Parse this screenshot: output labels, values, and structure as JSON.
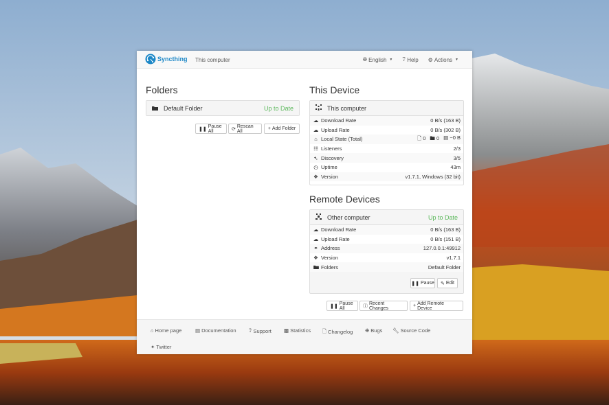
{
  "navbar": {
    "brand": "Syncthing",
    "device_name": "This computer",
    "language": "English",
    "help": "Help",
    "actions": "Actions"
  },
  "folders": {
    "heading": "Folders",
    "items": [
      {
        "name": "Default Folder",
        "status": "Up to Date"
      }
    ],
    "buttons": {
      "pause_all": "Pause All",
      "rescan_all": "Rescan All",
      "add_folder": "Add Folder"
    }
  },
  "this_device": {
    "heading": "This Device",
    "name": "This computer",
    "rows": [
      {
        "label": "Download Rate",
        "value": "0 B/s (163 B)",
        "icon": "cloud-download-icon"
      },
      {
        "label": "Upload Rate",
        "value": "0 B/s (302 B)",
        "icon": "cloud-upload-icon"
      },
      {
        "label": "Local State (Total)",
        "value": "",
        "icon": "home-icon"
      },
      {
        "label": "Listeners",
        "value": "2/3",
        "icon": "sitemap-icon"
      },
      {
        "label": "Discovery",
        "value": "3/5",
        "icon": "signpost-icon"
      },
      {
        "label": "Uptime",
        "value": "43m",
        "icon": "clock-icon"
      },
      {
        "label": "Version",
        "value": "v1.7.1, Windows (32 bit)",
        "icon": "tag-icon"
      }
    ],
    "local_state": {
      "files": "0",
      "folders": "0",
      "size": "~0 B"
    }
  },
  "remote_devices": {
    "heading": "Remote Devices",
    "name": "Other computer",
    "status": "Up to Date",
    "rows": [
      {
        "label": "Download Rate",
        "value": "0 B/s (163 B)",
        "icon": "cloud-download-icon"
      },
      {
        "label": "Upload Rate",
        "value": "0 B/s (151 B)",
        "icon": "cloud-upload-icon"
      },
      {
        "label": "Address",
        "value": "127.0.0.1:49912",
        "icon": "link-icon"
      },
      {
        "label": "Version",
        "value": "v1.7.1",
        "icon": "tag-icon"
      },
      {
        "label": "Folders",
        "value": "Default Folder",
        "icon": "folder-icon"
      }
    ],
    "buttons": {
      "pause": "Pause",
      "edit": "Edit",
      "pause_all": "Pause All",
      "recent_changes": "Recent Changes",
      "add_remote_device": "Add Remote Device"
    }
  },
  "footer": {
    "links": [
      "Home page",
      "Documentation",
      "Support",
      "Statistics",
      "Changelog",
      "Bugs",
      "Source Code",
      "Twitter"
    ]
  },
  "colors": {
    "brand": "#1e88c7",
    "up_to_date": "#5cb85c"
  }
}
